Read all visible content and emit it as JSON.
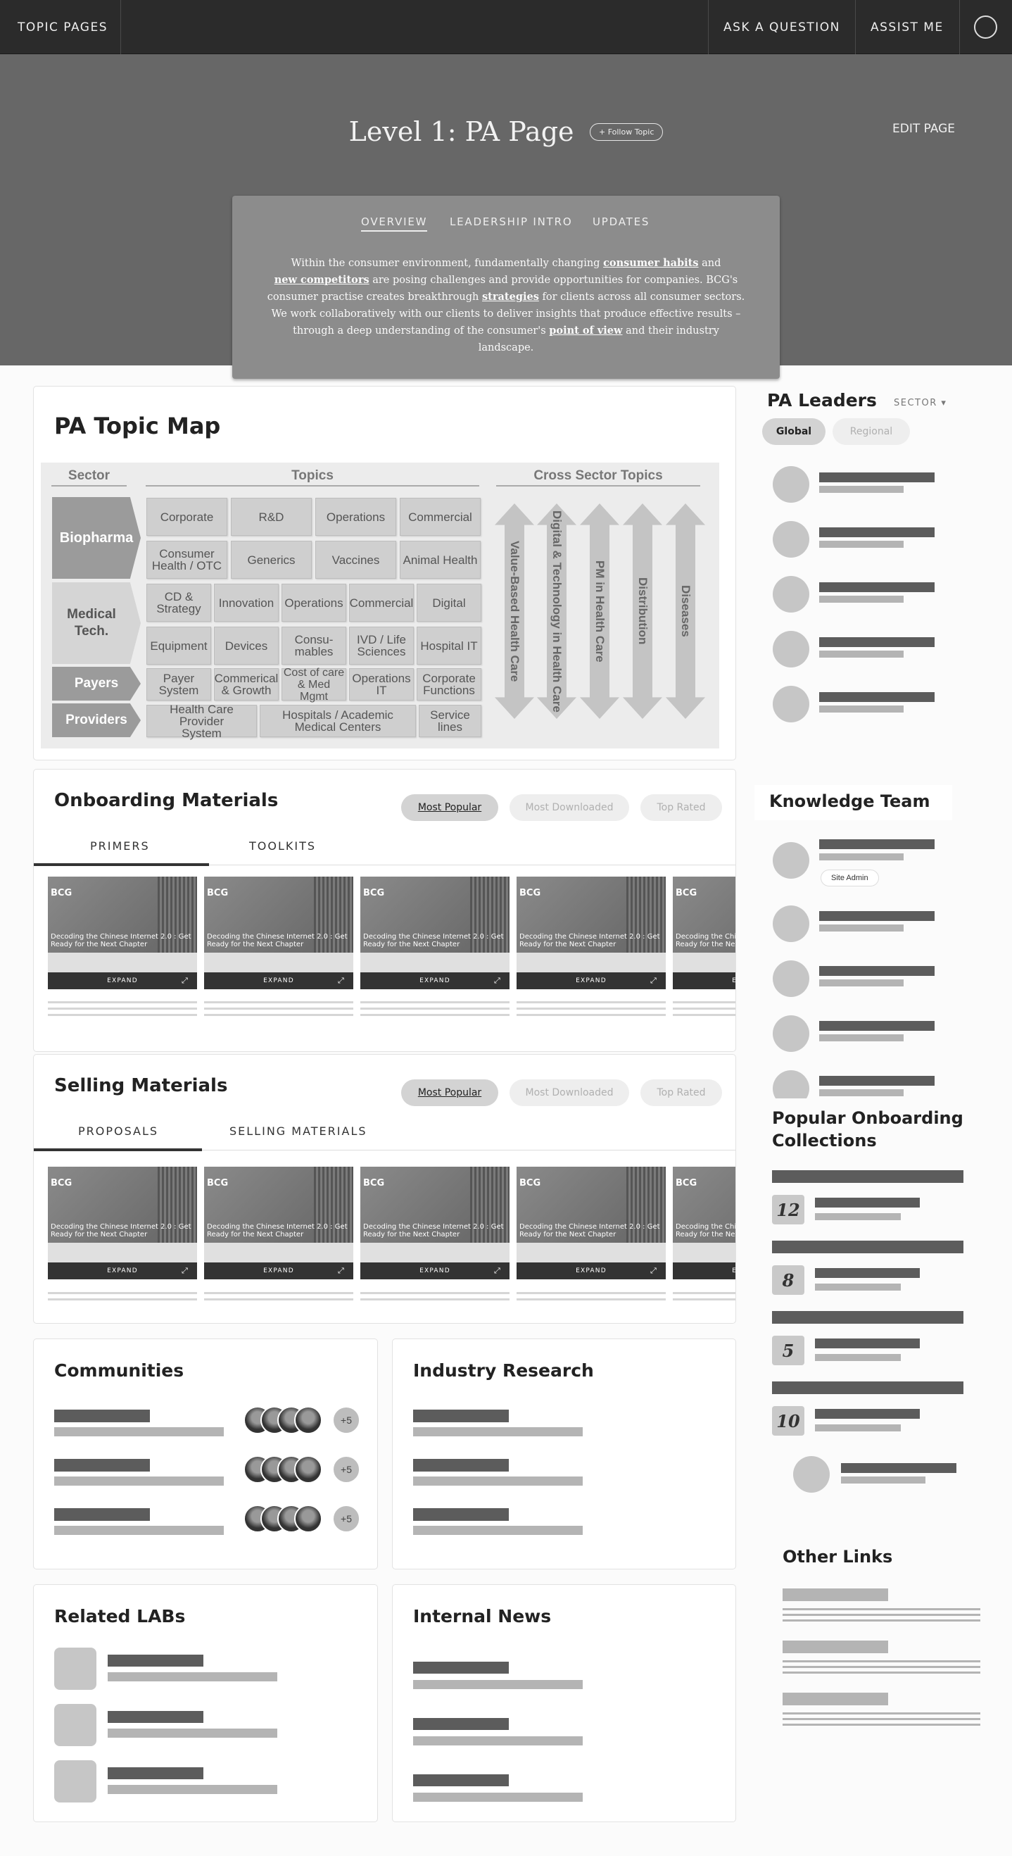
{
  "nav": {
    "topic_pages": "TOPIC PAGES",
    "ask": "ASK A QUESTION",
    "assist": "ASSIST ME"
  },
  "hero": {
    "title": "Level 1: PA Page",
    "follow": "+ Follow Topic",
    "edit": "EDIT PAGE"
  },
  "intro": {
    "tabs": [
      "OVERVIEW",
      "LEADERSHIP INTRO",
      "UPDATES"
    ],
    "text_parts": [
      "Within the consumer environment, fundamentally changing ",
      "consumer habits",
      " and ",
      "new competitors",
      " are posing challenges and provide opportunities for companies. BCG's consumer practise creates breakthrough ",
      "strategies",
      " for clients across all consumer sectors. We work collaboratively with our clients to deliver insights that produce effective results – through a deep understanding of the consumer's ",
      "point of view",
      " and their industry landscape."
    ]
  },
  "topic_map": {
    "title": "PA Topic Map",
    "headers": [
      "Sector",
      "Topics",
      "Cross Sector Topics"
    ],
    "sectors": [
      "Biopharma",
      "Medical Tech.",
      "Payers",
      "Providers"
    ],
    "topics": {
      "biopharma_1": [
        "Corporate",
        "R&D",
        "Operations",
        "Commercial"
      ],
      "biopharma_2": [
        "Consumer Health / OTC",
        "Generics",
        "Vaccines",
        "Animal Health"
      ],
      "medtech_1": [
        "CD & Strategy",
        "Innovation",
        "Operations",
        "Commercial",
        "Digital"
      ],
      "medtech_2": [
        "Equipment",
        "Devices",
        "Consu- mables",
        "IVD / Life Sciences",
        "Hospital IT"
      ],
      "payers": [
        "Payer System",
        "Commerical & Growth",
        "Cost of care & Med Mgmt",
        "Operations IT",
        "Corporate Functions"
      ],
      "providers": [
        "Health Care Provider System",
        "Hospitals / Academic Medical Centers",
        "Service lines"
      ]
    },
    "cross": [
      "Value-Based Health Care",
      "Digital & Technology in Health Care",
      "PM in Health Care",
      "Distribution",
      "Diseases"
    ]
  },
  "onboarding": {
    "title": "Onboarding Materials",
    "pills": [
      "Most Popular",
      "Most Downloaded",
      "Top Rated"
    ],
    "tabs": [
      "PRIMERS",
      "TOOLKITS"
    ]
  },
  "selling": {
    "title": "Selling Materials",
    "pills": [
      "Most Popular",
      "Most Downloaded",
      "Top Rated"
    ],
    "tabs": [
      "PROPOSALS",
      "SELLING MATERIALS"
    ]
  },
  "thumb": {
    "logo": "BCG",
    "caption": "Decoding the Chinese Internet 2.0 : Get Ready for the Next Chapter",
    "expand": "EXPAND"
  },
  "communities": {
    "title": "Communities",
    "more": "+5"
  },
  "industry_research": {
    "title": "Industry Research"
  },
  "related_labs": {
    "title": "Related LABs"
  },
  "internal_news": {
    "title": "Internal News"
  },
  "pa_leaders": {
    "title": "PA Leaders",
    "sector": "SECTOR",
    "pills": [
      "Global",
      "Regional"
    ]
  },
  "knowledge_team": {
    "title": "Knowledge Team",
    "badge": "Site Admin"
  },
  "popular_collections": {
    "title_1": "Popular Onboarding",
    "title_2": "Collections",
    "counts": [
      "12",
      "8",
      "5",
      "10"
    ]
  },
  "other_links": {
    "title": "Other Links"
  }
}
